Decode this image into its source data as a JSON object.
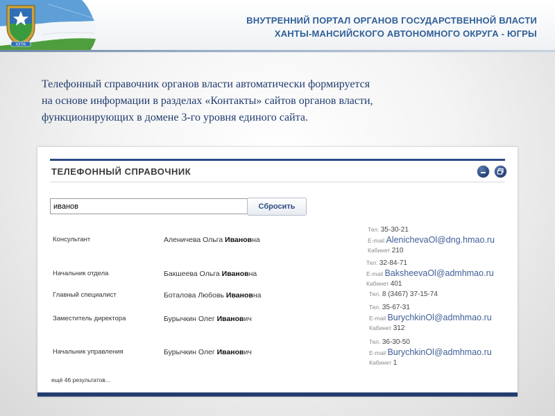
{
  "header": {
    "title_line1": "ВНУТРЕННИЙ ПОРТАЛ ОРГАНОВ ГОСУДАРСТВЕННОЙ ВЛАСТИ",
    "title_line2": "ХАНТЫ-МАНСИЙСКОГО АВТОНОМНОГО ОКРУГА - ЮГРЫ",
    "emblem_label": "ЮГРА",
    "emblem_icon": "coat-of-arms-icon",
    "flag_colors": [
      "#5f9fd8",
      "#ffffff",
      "#4f9e3e"
    ]
  },
  "intro": {
    "line1": "Телефонный справочник органов власти автоматически формируется",
    "line2": "на основе информации в разделах «Контакты» сайтов органов власти,",
    "line3": "функционирующих в домене 3-го уровня единого сайта."
  },
  "panel": {
    "title": "ТЕЛЕФОННЫЙ СПРАВОЧНИК",
    "minimize_icon": "minimize-icon",
    "maximize_icon": "maximize-icon",
    "search_value": "иванов",
    "reset_label": "Сбросить",
    "more_results": "ещё 46 результатов...",
    "accent_color": "#2b4a86"
  },
  "labels": {
    "phone": "Тел.",
    "email": "E-mail",
    "room": "Кабинет"
  },
  "results": [
    {
      "position": "Консультант",
      "name_pre": "Аленичева Ольга ",
      "name_bold": "Иванов",
      "name_post": "на",
      "phone": "35-30-21",
      "email": "AlenichevaOl@dng.hmao.ru",
      "room": "210"
    },
    {
      "position": "Начальник отдела",
      "name_pre": "Бакшеева Ольга ",
      "name_bold": "Иванов",
      "name_post": "на",
      "phone": "32-84-71",
      "email": "BaksheevaOl@admhmao.ru",
      "room": "401"
    },
    {
      "position": "Главный специалист",
      "name_pre": "Боталова Любовь ",
      "name_bold": "Иванов",
      "name_post": "на",
      "phone": "8 (3467) 37-15-74",
      "email": "",
      "room": ""
    },
    {
      "position": "Заместитель директора",
      "name_pre": "Бурычкин Олег ",
      "name_bold": "Иванов",
      "name_post": "ич",
      "phone": "35-67-31",
      "email": "BurychkinOl@admhmao.ru",
      "room": "312"
    },
    {
      "position": "Начальник управления",
      "name_pre": "Бурычкин Олег ",
      "name_bold": "Иванов",
      "name_post": "ич",
      "phone": "36-30-50",
      "email": "BurychkinOl@admhmao.ru",
      "room": "1"
    }
  ]
}
